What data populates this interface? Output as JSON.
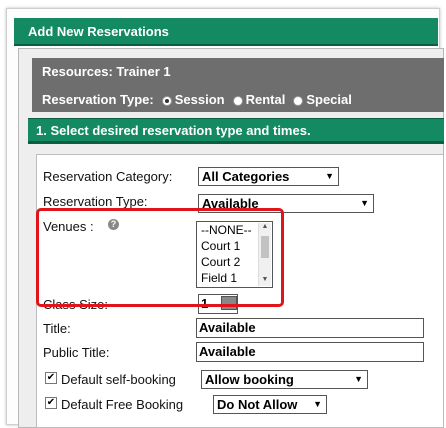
{
  "dialog": {
    "title": "Add New Reservations"
  },
  "resource": {
    "label": "Resources: Trainer 1"
  },
  "reservation_type": {
    "label": "Reservation Type:",
    "options": [
      "Session",
      "Rental",
      "Special"
    ],
    "selected": "Session"
  },
  "step": {
    "title": "1. Select desired reservation type and times."
  },
  "form": {
    "category_label": "Reservation Category:",
    "category_value": "All Categories",
    "type_label": "Reservation Type:",
    "type_value": "Available",
    "venues_label": "Venues :",
    "venues_options": [
      "--NONE--",
      "Court 1",
      "Court 2",
      "Field 1"
    ],
    "class_size_label": "Class Size:",
    "class_size_value": "1",
    "title_label": "Title:",
    "title_value": "Available",
    "public_title_label": "Public Title:",
    "public_title_value": "Available",
    "self_booking_label": "Default self-booking",
    "self_booking_checked": true,
    "self_booking_value": "Allow booking",
    "free_booking_label": "Default Free Booking",
    "free_booking_checked": true,
    "free_booking_value": "Do Not Allow"
  },
  "colors": {
    "accent": "#138a62",
    "header_gray": "#6e6e6e",
    "highlight": "#e0141b"
  }
}
